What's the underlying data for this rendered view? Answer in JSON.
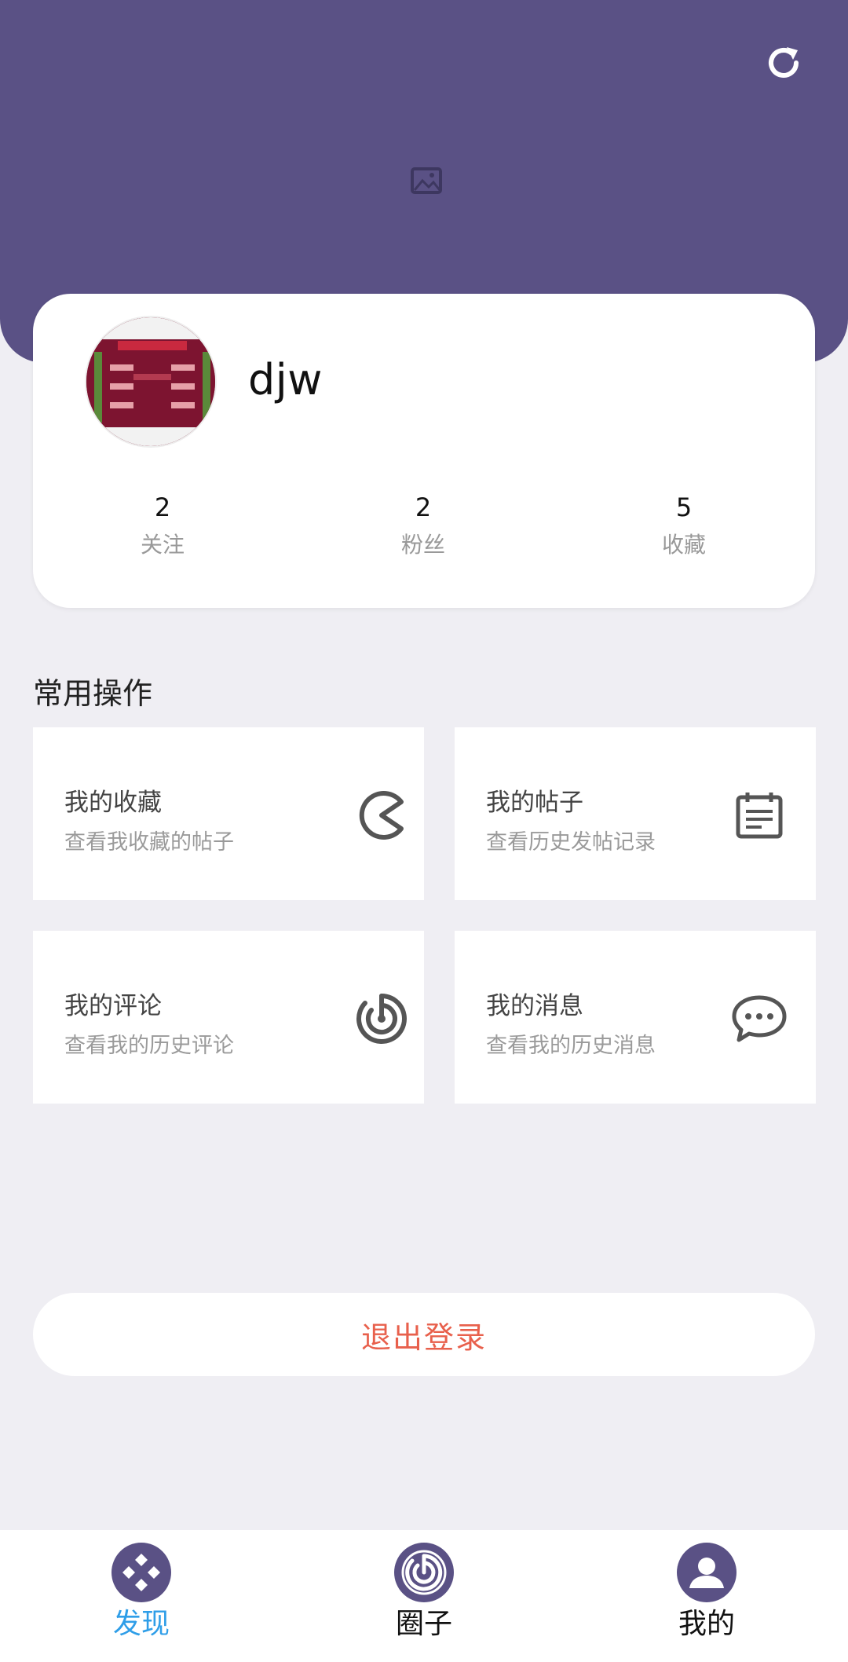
{
  "header": {
    "refresh_icon": "refresh-icon",
    "image_placeholder_icon": "image-icon",
    "background_color": "#5a5185"
  },
  "profile": {
    "username": "djw",
    "stats": [
      {
        "value": "2",
        "label": "关注"
      },
      {
        "value": "2",
        "label": "粉丝"
      },
      {
        "value": "5",
        "label": "收藏"
      }
    ]
  },
  "common_actions": {
    "title": "常用操作",
    "items": [
      {
        "title": "我的收藏",
        "subtitle": "查看我收藏的帖子",
        "icon": "pacman-icon"
      },
      {
        "title": "我的帖子",
        "subtitle": "查看历史发帖记录",
        "icon": "calendar-note-icon"
      },
      {
        "title": "我的评论",
        "subtitle": "查看我的历史评论",
        "icon": "radar-icon"
      },
      {
        "title": "我的消息",
        "subtitle": "查看我的历史消息",
        "icon": "chat-bubble-icon"
      }
    ]
  },
  "logout": {
    "label": "退出登录",
    "color": "#e8604c"
  },
  "bottom_nav": {
    "items": [
      {
        "label": "发现",
        "icon": "gamepad-icon",
        "active": true,
        "color": "#2f9ee8"
      },
      {
        "label": "圈子",
        "icon": "radar-icon",
        "active": false,
        "color": "#111111"
      },
      {
        "label": "我的",
        "icon": "user-icon",
        "active": false,
        "color": "#111111"
      }
    ]
  }
}
